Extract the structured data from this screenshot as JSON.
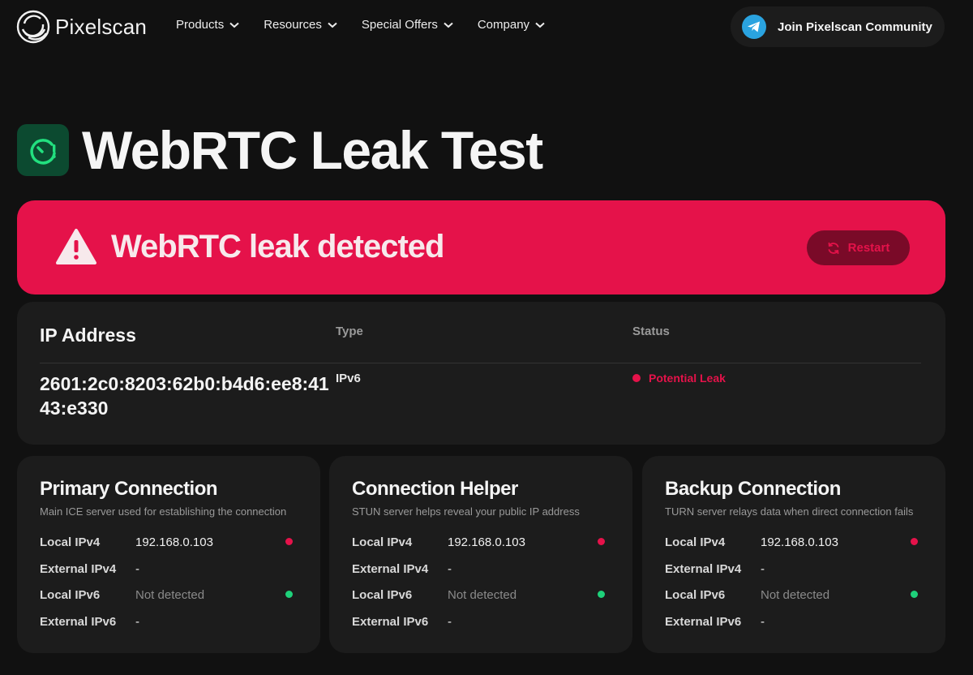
{
  "brand": {
    "name": "Pixelscan"
  },
  "nav": [
    {
      "label": "Products"
    },
    {
      "label": "Resources"
    },
    {
      "label": "Special Offers"
    },
    {
      "label": "Company"
    }
  ],
  "community_button": {
    "label": "Join Pixelscan Community"
  },
  "page": {
    "title": "WebRTC Leak Test"
  },
  "alert": {
    "text": "WebRTC leak detected",
    "restart_label": "Restart",
    "color": "#e5124a"
  },
  "ip_table": {
    "headers": {
      "ip": "IP Address",
      "type": "Type",
      "status": "Status"
    },
    "rows": [
      {
        "ip": "2601:2c0:8203:62b0:b4d6:ee8:4143:e330",
        "type": "IPv6",
        "status": "Potential Leak"
      }
    ]
  },
  "connections": [
    {
      "title": "Primary Connection",
      "description": "Main ICE server used for establishing the connection",
      "rows": [
        {
          "label": "Local IPv4",
          "value": "192.168.0.103",
          "indicator": "red"
        },
        {
          "label": "External IPv4",
          "value": "-",
          "indicator": "none"
        },
        {
          "label": "Local IPv6",
          "value": "Not detected",
          "indicator": "green"
        },
        {
          "label": "External IPv6",
          "value": "-",
          "indicator": "none"
        }
      ]
    },
    {
      "title": "Connection Helper",
      "description": "STUN server helps reveal your public IP address",
      "rows": [
        {
          "label": "Local IPv4",
          "value": "192.168.0.103",
          "indicator": "red"
        },
        {
          "label": "External IPv4",
          "value": "-",
          "indicator": "none"
        },
        {
          "label": "Local IPv6",
          "value": "Not detected",
          "indicator": "green"
        },
        {
          "label": "External IPv6",
          "value": "-",
          "indicator": "none"
        }
      ]
    },
    {
      "title": "Backup Connection",
      "description": "TURN server relays data when direct connection fails",
      "rows": [
        {
          "label": "Local IPv4",
          "value": "192.168.0.103",
          "indicator": "red"
        },
        {
          "label": "External IPv4",
          "value": "-",
          "indicator": "none"
        },
        {
          "label": "Local IPv6",
          "value": "Not detected",
          "indicator": "green"
        },
        {
          "label": "External IPv6",
          "value": "-",
          "indicator": "none"
        }
      ]
    }
  ],
  "colors": {
    "background": "#111111",
    "card": "#1c1c1c",
    "danger": "#e5124a",
    "success": "#1ed17a",
    "icon_bg": "#0c4a30"
  },
  "icons": [
    "pixelscan-logo-icon",
    "chevron-down-icon",
    "telegram-icon",
    "leak-gauge-icon",
    "warning-icon",
    "refresh-icon"
  ]
}
